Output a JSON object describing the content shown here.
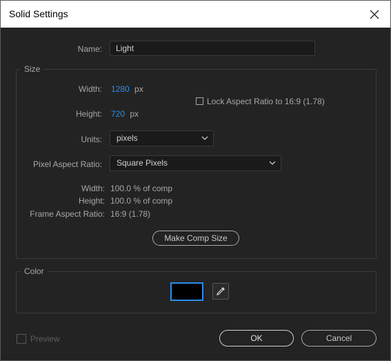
{
  "window": {
    "title": "Solid Settings"
  },
  "name_row": {
    "label": "Name:",
    "value": "Light"
  },
  "size": {
    "legend": "Size",
    "width_label": "Width:",
    "width_value": "1280",
    "width_unit": "px",
    "height_label": "Height:",
    "height_value": "720",
    "height_unit": "px",
    "lock_label": "Lock Aspect Ratio to 16:9 (1.78)",
    "lock_checked": false,
    "units_label": "Units:",
    "units_value": "pixels",
    "par_label": "Pixel Aspect Ratio:",
    "par_value": "Square Pixels",
    "info_width_label": "Width:",
    "info_width_value": "100.0 % of comp",
    "info_height_label": "Height:",
    "info_height_value": "100.0 % of comp",
    "info_far_label": "Frame Aspect Ratio:",
    "info_far_value": "16:9 (1.78)",
    "make_comp_label": "Make Comp Size"
  },
  "color": {
    "legend": "Color",
    "swatch": "#000000",
    "eyedropper_icon": "eyedropper-icon"
  },
  "footer": {
    "preview_label": "Preview",
    "preview_checked": false,
    "ok_label": "OK",
    "cancel_label": "Cancel"
  },
  "colors": {
    "accent": "#2d8ceb",
    "background": "#232323",
    "field": "#1a1a1a"
  }
}
